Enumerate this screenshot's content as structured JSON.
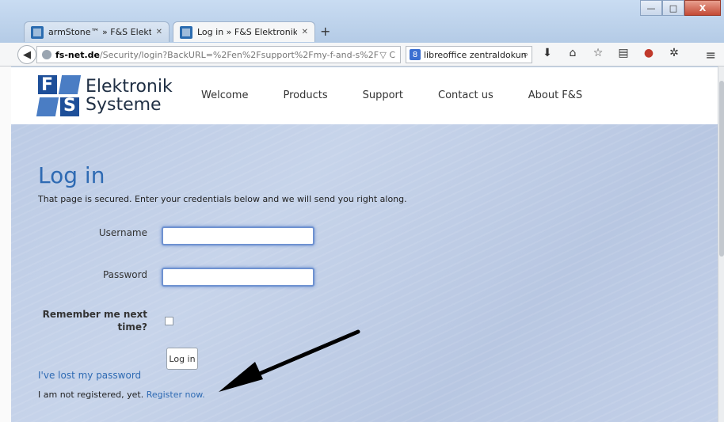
{
  "browser": {
    "tabs": [
      {
        "title": "armStone™ » F&S Elektroni...",
        "active": false
      },
      {
        "title": "Log in » F&S Elektronik Sys...",
        "active": true
      }
    ],
    "new_tab": "+",
    "url_domain": "fs-net.de",
    "url_path": "/Security/login?BackURL=%2Fen%2Fsupport%2Fmy-f-and-s%2F",
    "url_tools": "▽ C",
    "search_text": "libreoffice zentraldokun",
    "search_engine_icon": "8",
    "window_buttons": {
      "minimize": "—",
      "maximize": "□",
      "close": "X"
    }
  },
  "site": {
    "logo": {
      "line1": "Elektronik",
      "line2": "Systeme",
      "mark1": "F",
      "mark2": "S"
    },
    "nav": [
      "Welcome",
      "Products",
      "Support",
      "Contact us",
      "About F&S"
    ]
  },
  "login": {
    "title": "Log in",
    "lead": "That page is secured. Enter your credentials below and we will send you right along.",
    "username_label": "Username",
    "password_label": "Password",
    "remember_label_1": "Remember me next",
    "remember_label_2": "time?",
    "button": "Log in",
    "lost_password": "I've lost my password",
    "not_registered": "I am not registered, yet.",
    "register_link": "Register now."
  },
  "colors": {
    "accent": "#2e6ab3",
    "background": "#bcd0e8",
    "input_focus": "#6f92d1"
  }
}
